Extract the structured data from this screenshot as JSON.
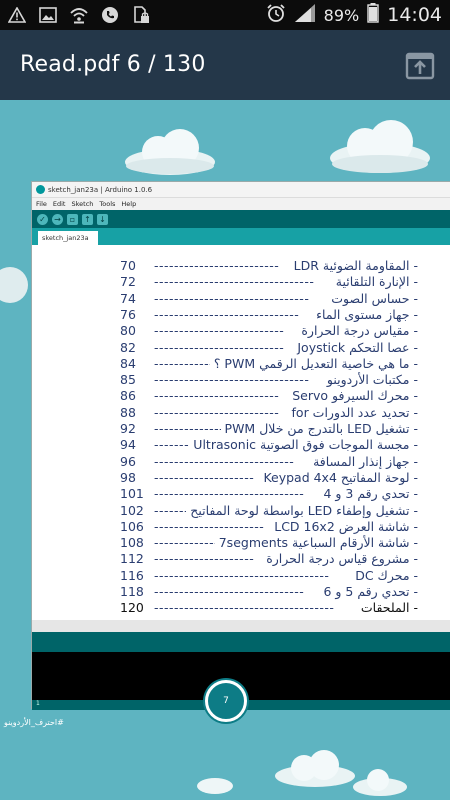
{
  "status_bar": {
    "battery": "89%",
    "time": "14:04",
    "left_icons": [
      "warning-icon",
      "image-icon",
      "wifi-call-icon",
      "phone-icon",
      "sim-lock-icon"
    ],
    "right_icons": [
      "alarm-icon",
      "signal-icon",
      "battery-icon"
    ]
  },
  "app_bar": {
    "title": "Read.pdf 6 / 130",
    "open_in_icon": "open-in-app-icon"
  },
  "arduino": {
    "window_title": "sketch_jan23a | Arduino 1.0.6",
    "menus": [
      "File",
      "Edit",
      "Sketch",
      "Tools",
      "Help"
    ],
    "tab": "sketch_jan23a",
    "footer_line": "1"
  },
  "toc": [
    {
      "text": "- المقاومة الضوئية LDR",
      "page": "70"
    },
    {
      "text": "- الإنارة التلقائية",
      "page": "72"
    },
    {
      "text": "- حساس الصوت",
      "page": "74"
    },
    {
      "text": "- جهاز مستوى الماء",
      "page": "76"
    },
    {
      "text": "- مقياس درجة الحرارة",
      "page": "80"
    },
    {
      "text": "- عصا التحكم Joystick",
      "page": "82"
    },
    {
      "text": "- ما هي خاصية التعديل الرقمي PWM ؟",
      "page": "84"
    },
    {
      "text": "- مكتبات الأردوينو",
      "page": "85"
    },
    {
      "text": "- محرك السيرفو Servo",
      "page": "86"
    },
    {
      "text": "- تحديد عدد الدورات for",
      "page": "88"
    },
    {
      "text": "- تشغيل LED بالتدرج من خلال PWM",
      "page": "92"
    },
    {
      "text": "- مجسة الموجات فوق الصوتية Ultrasonic",
      "page": "94"
    },
    {
      "text": "- جهاز إنذار المسافة",
      "page": "96"
    },
    {
      "text": "- لوحة المفاتيح Keypad 4x4",
      "page": "98"
    },
    {
      "text": "- تحدي رقم 3 و 4",
      "page": "101"
    },
    {
      "text": "- تشغيل وإطفاء LED بواسطة لوحة المفاتيح",
      "page": "102"
    },
    {
      "text": "- شاشة العرض LCD 16x2",
      "page": "106"
    },
    {
      "text": "- شاشة الأرقام السباعية 7segments",
      "page": "108"
    },
    {
      "text": "- مشروع قياس درجة الحرارة",
      "page": "112"
    },
    {
      "text": "- محرك DC",
      "page": "116"
    },
    {
      "text": "- تحدي رقم 5 و 6",
      "page": "118"
    },
    {
      "text": "- الملحقات",
      "page": "120"
    }
  ],
  "page_badge": "7",
  "hashtag": "#احترف_الأردوينو"
}
